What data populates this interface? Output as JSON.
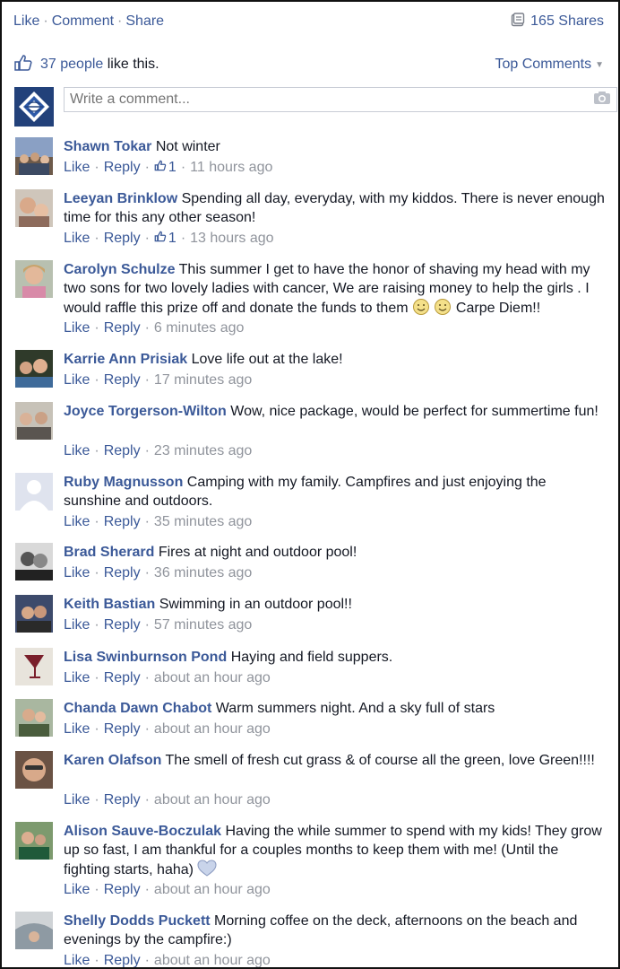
{
  "header": {
    "like_label": "Like",
    "comment_label": "Comment",
    "share_label": "Share",
    "separator": "·",
    "shares_count": "165 Shares"
  },
  "likes": {
    "count_text": "37 people",
    "suffix": " like this.",
    "sort_label": "Top Comments"
  },
  "compose": {
    "placeholder": "Write a comment..."
  },
  "actions": {
    "like": "Like",
    "reply": "Reply"
  },
  "comments": [
    {
      "name": "Shawn Tokar",
      "text": "Not winter",
      "likes": "1",
      "time": "11 hours ago"
    },
    {
      "name": "Leeyan Brinklow",
      "text": "Spending all day, everyday, with my kiddos. There is never enough time for this any other season!",
      "likes": "1",
      "time": "13 hours ago"
    },
    {
      "name": "Carolyn Schulze",
      "text": "This summer I get to have the honor of shaving my head with my two sons for two lovely ladies with cancer, We are raising money to help the girls . I would raffle this prize off and donate the funds to them",
      "text_end": "Carpe Diem!!",
      "time": "6 minutes ago"
    },
    {
      "name": "Karrie Ann Prisiak",
      "text": "Love life out at the lake!",
      "time": "17 minutes ago"
    },
    {
      "name": "Joyce Torgerson-Wilton",
      "text": "Wow, nice package, would be perfect for summertime fun!",
      "time": "23 minutes ago"
    },
    {
      "name": "Ruby Magnusson",
      "text": "Camping with my family. Campfires and just enjoying the sunshine and outdoors.",
      "time": "35 minutes ago"
    },
    {
      "name": "Brad Sherard",
      "text": "Fires at night and outdoor pool!",
      "time": "36 minutes ago"
    },
    {
      "name": "Keith Bastian",
      "text": "Swimming in an outdoor pool!!",
      "time": "57 minutes ago"
    },
    {
      "name": "Lisa Swinburnson Pond",
      "text": "Haying and field suppers.",
      "time": "about an hour ago"
    },
    {
      "name": "Chanda Dawn Chabot",
      "text": "Warm summers night. And a sky full of stars",
      "time": "about an hour ago"
    },
    {
      "name": "Karen Olafson",
      "text": "The smell of fresh cut grass & of course all the green, love Green!!!!",
      "time": "about an hour ago"
    },
    {
      "name": "Alison Sauve-Boczulak",
      "text": "Having the while summer to spend with my kids! They grow up so fast, I am thankful for a couples months to keep them with me! (Until the fighting starts, haha)",
      "time": "about an hour ago"
    },
    {
      "name": "Shelly Dodds Puckett",
      "text": "Morning coffee on the deck, afternoons on the beach and evenings by the campfire:)",
      "time": "about an hour ago"
    }
  ],
  "colors": {
    "link_blue": "#3b5998",
    "meta_gray": "#90949c",
    "text": "#141823",
    "border": "#c9cdd6"
  }
}
